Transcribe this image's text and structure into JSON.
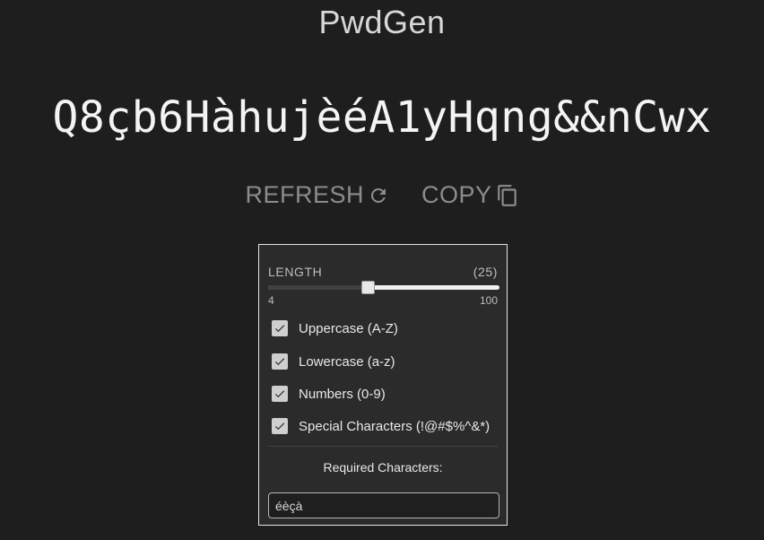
{
  "app": {
    "title": "PwdGen"
  },
  "password": {
    "value": "Q8çb6HàhujèéA1yHqng&&nCwx"
  },
  "actions": {
    "refresh_label": "REFRESH",
    "refresh_icon": "refresh-icon",
    "copy_label": "COPY",
    "copy_icon": "copy-icon"
  },
  "settings": {
    "length_label": "LENGTH",
    "length_display": "(25)",
    "length_value": 25,
    "length_min": 4,
    "length_max": 100,
    "min_label": "4",
    "max_label": "100",
    "options": [
      {
        "label": "Uppercase (A-Z)",
        "checked": true
      },
      {
        "label": "Lowercase (a-z)",
        "checked": true
      },
      {
        "label": "Numbers (0-9)",
        "checked": true
      },
      {
        "label": "Special Characters (!@#$%^&*)",
        "checked": true
      }
    ],
    "required_label": "Required Characters:",
    "required_value": "éèçà"
  },
  "colors": {
    "background": "#1e1e1e",
    "panel": "#2b2b2b",
    "muted_action": "#8c8c8c"
  }
}
